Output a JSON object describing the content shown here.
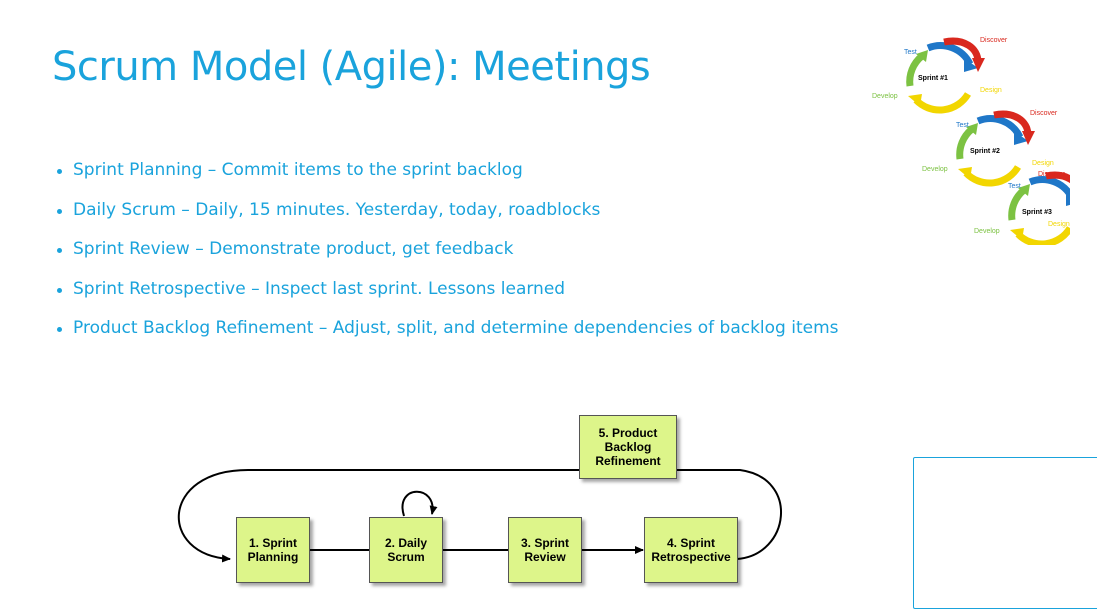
{
  "title": "Scrum Model (Agile): Meetings",
  "bullets": [
    "Sprint Planning – Commit items to the sprint backlog",
    "Daily Scrum – Daily, 15 minutes.  Yesterday, today, roadblocks",
    "Sprint Review – Demonstrate product, get feedback",
    "Sprint Retrospective – Inspect last sprint. Lessons learned",
    "Product Backlog Refinement – Adjust, split, and determine dependencies of backlog items"
  ],
  "diagram": {
    "nodes": [
      "1. Sprint\nPlanning",
      "2. Daily\nScrum",
      "3. Sprint\nReview",
      "4. Sprint\nRetrospective",
      "5. Product\nBacklog\nRefinement"
    ]
  },
  "sprint_cycles": [
    {
      "sprint": "Sprint #1",
      "test": "Test",
      "discover": "Discover",
      "design": "Design",
      "develop": "Develop"
    },
    {
      "sprint": "Sprint #2",
      "test": "Test",
      "discover": "Discover",
      "design": "Design",
      "develop": "Develop"
    },
    {
      "sprint": "Sprint #3",
      "test": "Test",
      "discover": "Discover",
      "design": "Design",
      "develop": "Develop"
    }
  ],
  "colors": {
    "title": "#1aa3dc",
    "node_fill": "#ddf58a",
    "cycle_red": "#d9281e",
    "cycle_blue": "#1f77c8",
    "cycle_yellow": "#f2d600",
    "cycle_green": "#7cc242"
  }
}
